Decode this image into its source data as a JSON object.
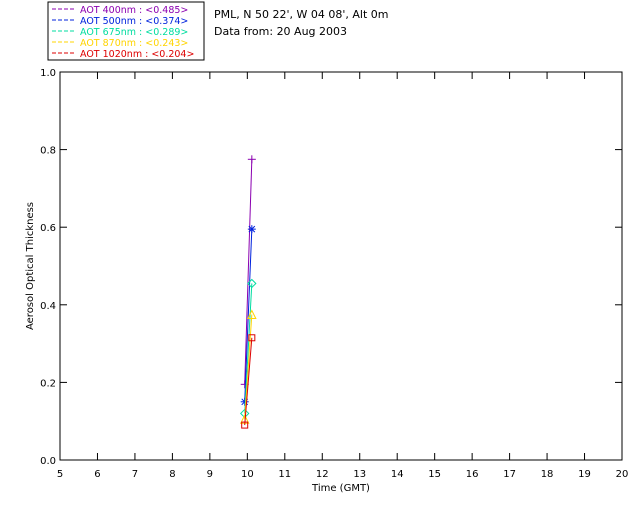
{
  "chart_data": {
    "type": "line",
    "title_lines": [
      "PML, N 50 22', W 04 08', Alt 0m",
      "Data from: 20 Aug 2003"
    ],
    "xlabel": "Time (GMT)",
    "ylabel": "Aerosol Optical Thickness",
    "xlim": [
      5,
      20
    ],
    "ylim": [
      0.0,
      1.0
    ],
    "x_ticks": [
      "5",
      "6",
      "7",
      "8",
      "9",
      "10",
      "11",
      "12",
      "13",
      "14",
      "15",
      "16",
      "17",
      "18",
      "19",
      "20"
    ],
    "y_ticks": [
      "0.0",
      "0.2",
      "0.4",
      "0.6",
      "0.8",
      "1.0"
    ],
    "grid": false,
    "legend_position": "top-left (outside plot)",
    "series": [
      {
        "name": "AOT  400nm : <0.485>",
        "color": "#8b00b0",
        "marker": "plus",
        "x": [
          9.93,
          10.12
        ],
        "y": [
          0.195,
          0.775
        ]
      },
      {
        "name": "AOT  500nm : <0.374>",
        "color": "#0022dd",
        "marker": "asterisk",
        "x": [
          9.93,
          10.12
        ],
        "y": [
          0.15,
          0.595
        ]
      },
      {
        "name": "AOT  675nm : <0.289>",
        "color": "#00dda0",
        "marker": "diamond",
        "x": [
          9.93,
          10.12
        ],
        "y": [
          0.12,
          0.455
        ]
      },
      {
        "name": "AOT  870nm : <0.243>",
        "color": "#ffd400",
        "marker": "triangle",
        "x": [
          9.93,
          10.12
        ],
        "y": [
          0.105,
          0.375
        ]
      },
      {
        "name": "AOT 1020nm : <0.204>",
        "color": "#dd0000",
        "marker": "square",
        "x": [
          9.93,
          10.12
        ],
        "y": [
          0.09,
          0.315
        ]
      }
    ]
  }
}
